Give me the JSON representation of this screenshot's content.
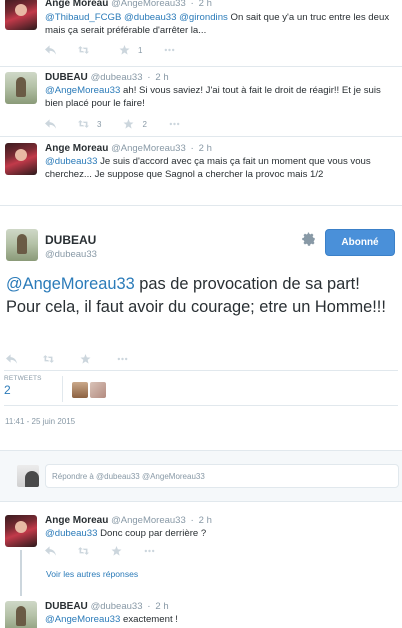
{
  "icons": {
    "reply": "reply-icon",
    "retweet": "retweet-icon",
    "favorite": "star-icon",
    "more": "more-icon",
    "settings": "gear-icon"
  },
  "colors": {
    "link": "#2b7bb9",
    "follow_button": "#4a90d9",
    "muted": "#8899a6"
  },
  "tweets_above": [
    {
      "name": "Ange Moreau",
      "handle": "@AngeMoreau33",
      "time": "2 h",
      "mentions": "@Thibaud_FCGB @dubeau33 @girondins",
      "text": " On sait que y'a un truc entre les deux mais ça serait préférable d'arrêter la...",
      "retweets": "",
      "favorites": "1"
    },
    {
      "name": "DUBEAU",
      "handle": "@dubeau33",
      "time": "2 h",
      "mentions": "@AngeMoreau33",
      "text": " ah! Si vous saviez! J'ai tout à fait le droit de réagir!! Et je suis bien placé pour le faire!",
      "retweets": "3",
      "favorites": "2"
    },
    {
      "name": "Ange Moreau",
      "handle": "@AngeMoreau33",
      "time": "2 h",
      "mentions": "@dubeau33",
      "text": " Je suis d'accord avec ça mais ça fait un moment que vous vous cherchez...  Je suppose que Sagnol a chercher la provoc mais 1/2",
      "retweets": "",
      "favorites": ""
    }
  ],
  "main_tweet": {
    "name": "DUBEAU",
    "handle": "@dubeau33",
    "follow_label": "Abonné",
    "mention": "@AngeMoreau33",
    "text": " pas de provocation de sa part! Pour cela, il faut avoir du courage; etre un Homme!!!",
    "retweets_label": "RETWEETS",
    "retweets_count": "2",
    "datetime": "11:41 - 25 juin 2015"
  },
  "reply_box": {
    "placeholder": "Répondre à @dubeau33 @AngeMoreau33"
  },
  "replies": [
    {
      "name": "Ange Moreau",
      "handle": "@AngeMoreau33",
      "time": "2 h",
      "mentions": "@dubeau33",
      "text": " Donc coup par derrière ?"
    },
    {
      "name": "DUBEAU",
      "handle": "@dubeau33",
      "time": "2 h",
      "mentions": "@AngeMoreau33",
      "text": " exactement !"
    }
  ],
  "more_replies_label": "Voir les autres réponses"
}
